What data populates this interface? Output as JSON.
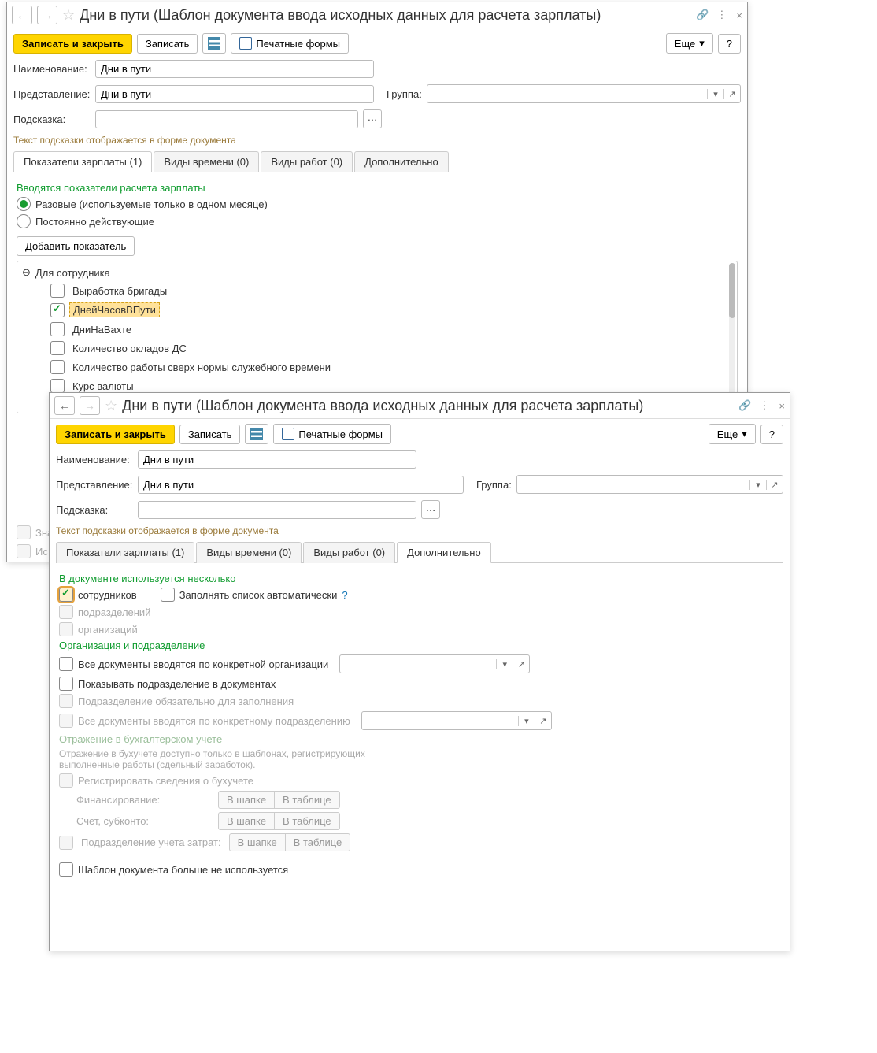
{
  "window_title": "Дни в пути (Шаблон документа ввода исходных данных для расчета зарплаты)",
  "toolbar": {
    "save_close": "Записать и закрыть",
    "save": "Записать",
    "print_forms": "Печатные формы",
    "more": "Еще",
    "help": "?"
  },
  "fields": {
    "name_label": "Наименование:",
    "name_value": "Дни в пути",
    "repr_label": "Представление:",
    "repr_value": "Дни в пути",
    "group_label": "Группа:",
    "hint_label": "Подсказка:",
    "hint_note": "Текст подсказки отображается в форме документа"
  },
  "tabs": {
    "t1": "Показатели зарплаты (1)",
    "t2": "Виды времени (0)",
    "t3": "Виды работ (0)",
    "t4": "Дополнительно"
  },
  "tab1": {
    "section": "Вводятся показатели расчета зарплаты",
    "radio1": "Разовые (используемые только в одном месяце)",
    "radio2": "Постоянно действующие",
    "add_btn": "Добавить показатель",
    "tree_root": "Для сотрудника",
    "items": [
      "Выработка бригады",
      "ДнейЧасовВПути",
      "ДниНаВахте",
      "Количество окладов ДС",
      "Количество работы сверх нормы служебного времени",
      "Курс валюты"
    ],
    "cut1": "Зна",
    "cut2": "Ис"
  },
  "tab4": {
    "section1": "В документе используется несколько",
    "chk_emp": "сотрудников",
    "chk_auto": "Заполнять список автоматически",
    "chk_dept": "подразделений",
    "chk_org": "организаций",
    "section2": "Организация и подразделение",
    "chk_all_org": "Все документы вводятся по конкретной организации",
    "chk_show_dept": "Показывать подразделение в документах",
    "chk_dept_req": "Подразделение обязательно для заполнения",
    "chk_all_dept": "Все документы вводятся по конкретному подразделению",
    "section3": "Отражение в бухгалтерском учете",
    "section3_note": "Отражение в бухучете доступно только в шаблонах, регистрирующих выполненные работы (сдельный заработок).",
    "chk_reg": "Регистрировать сведения о бухучете",
    "fin_label": "Финансирование:",
    "acc_label": "Счет, субконто:",
    "chk_dept_cost": "Подразделение учета затрат:",
    "opt_header": "В шапке",
    "opt_table": "В таблице",
    "chk_unused": "Шаблон документа больше не используется"
  }
}
